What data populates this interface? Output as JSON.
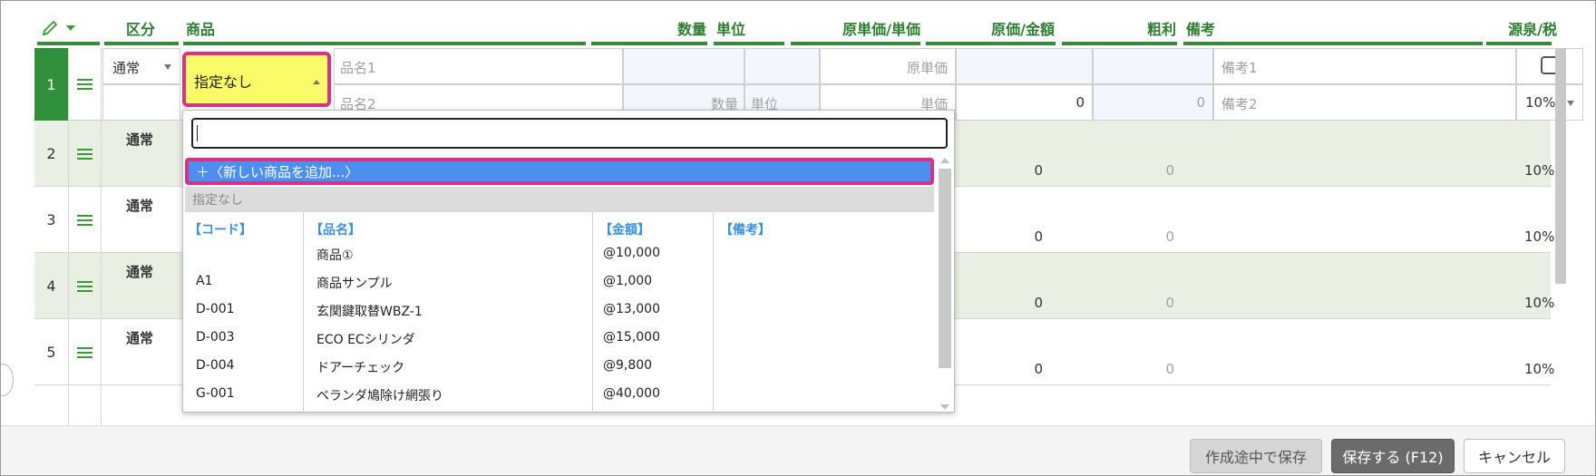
{
  "header": {
    "kubun": "区分",
    "shohin": "商品",
    "suryo": "数量",
    "tani": "単位",
    "gen_tanka": "原単価/単価",
    "genka_kingaku": "原価/金額",
    "arari": "粗利",
    "biko": "備考",
    "gensen_zei": "源泉/税"
  },
  "edit_row": {
    "num": "1",
    "kubun": "通常",
    "product": "指定なし",
    "name1_placeholder": "品名1",
    "name2_placeholder": "品名2",
    "qty_placeholder": "数量",
    "unit_placeholder": "単位",
    "cost_unit_placeholder": "原単価",
    "unit_price_placeholder": "単価",
    "amount": "0",
    "profit": "0",
    "note1_placeholder": "備考1",
    "note2_placeholder": "備考2",
    "tax": "10%"
  },
  "rows": [
    {
      "num": "2",
      "kubun": "通常",
      "amount": "0",
      "profit": "0",
      "tax": "10%"
    },
    {
      "num": "3",
      "kubun": "通常",
      "amount": "0",
      "profit": "0",
      "tax": "10%"
    },
    {
      "num": "4",
      "kubun": "通常",
      "amount": "0",
      "profit": "0",
      "tax": "10%"
    },
    {
      "num": "5",
      "kubun": "通常",
      "amount": "0",
      "profit": "0",
      "tax": "10%"
    }
  ],
  "dropdown": {
    "add_new": "＋〈新しい商品を追加...〉",
    "none": "指定なし",
    "headers": [
      "【コード】",
      "【品名】",
      "【金額】",
      "【備考】"
    ],
    "items": [
      {
        "code": "",
        "name": "商品①",
        "price": "@10,000",
        "note": ""
      },
      {
        "code": "A1",
        "name": "商品サンプル",
        "price": "@1,000",
        "note": ""
      },
      {
        "code": "D-001",
        "name": "玄関鍵取替WBZ-1",
        "price": "@13,000",
        "note": ""
      },
      {
        "code": "D-003",
        "name": "ECO ECシリンダ",
        "price": "@15,000",
        "note": ""
      },
      {
        "code": "D-004",
        "name": "ドアーチェック",
        "price": "@9,800",
        "note": ""
      },
      {
        "code": "G-001",
        "name": "ベランダ鳩除け網張り",
        "price": "@40,000",
        "note": ""
      }
    ]
  },
  "footer": {
    "draft": "作成途中で保存",
    "save": "保存する (F12)",
    "cancel": "キャンセル"
  },
  "colors": {
    "header_green": "#2e7d32",
    "active_row": "#2f8f3a",
    "highlight_border": "#d63384",
    "product_bg": "#fbfb6a",
    "add_new_bg": "#4d8ff0"
  }
}
